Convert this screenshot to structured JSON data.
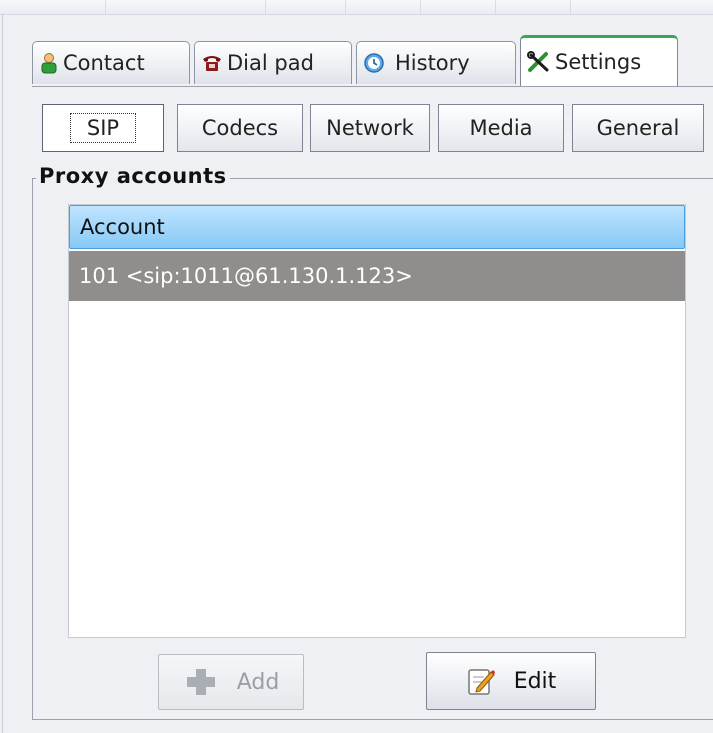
{
  "main_tabs": [
    {
      "label": "Contact",
      "icon": "contact-icon"
    },
    {
      "label": "Dial pad",
      "icon": "telephone-icon"
    },
    {
      "label": "History",
      "icon": "clock-icon"
    },
    {
      "label": "Settings",
      "icon": "tools-icon",
      "active": true
    }
  ],
  "sub_tabs": [
    {
      "label": "SIP",
      "active": true
    },
    {
      "label": "Codecs"
    },
    {
      "label": "Network"
    },
    {
      "label": "Media"
    },
    {
      "label": "General"
    }
  ],
  "proxy_group": {
    "title": "Proxy accounts",
    "column_header": "Account",
    "rows": [
      "101 <sip:1011@61.130.1.123>"
    ]
  },
  "buttons": {
    "add_label": "Add",
    "edit_label": "Edit"
  },
  "colors": {
    "active_tab_accent": "#36a852",
    "header_blue": "#86c9f5",
    "selected_row": "#8f8e8c"
  }
}
